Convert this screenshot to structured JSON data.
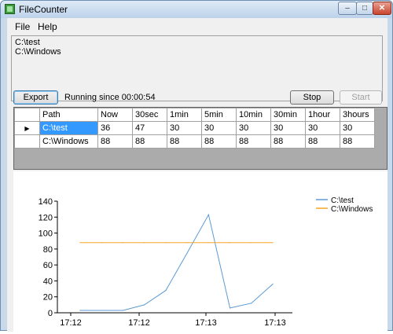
{
  "window": {
    "title": "FileCounter"
  },
  "menu": {
    "file": "File",
    "help": "Help"
  },
  "paths": [
    "C:\\test",
    "C:\\Windows"
  ],
  "toolbar": {
    "export_label": "Export",
    "status": "Running since 00:00:54",
    "stop_label": "Stop",
    "start_label": "Start"
  },
  "table": {
    "columns": [
      "Path",
      "Now",
      "30sec",
      "1min",
      "5min",
      "10min",
      "30min",
      "1hour",
      "3hours"
    ],
    "rows": [
      {
        "path": "C:\\test",
        "values": [
          "36",
          "47",
          "30",
          "30",
          "30",
          "30",
          "30",
          "30"
        ]
      },
      {
        "path": "C:\\Windows",
        "values": [
          "88",
          "88",
          "88",
          "88",
          "88",
          "88",
          "88",
          "88"
        ]
      }
    ]
  },
  "chart_data": {
    "type": "line",
    "ylim": [
      0,
      140
    ],
    "yticks": [
      0,
      20,
      40,
      60,
      80,
      100,
      120,
      140
    ],
    "xtick_labels": [
      "17:12",
      "17:12",
      "17:13",
      "17:13"
    ],
    "grid": false,
    "legend_position": "top-right",
    "series": [
      {
        "name": "C:\\test",
        "color": "#5b9bd5",
        "values": [
          3,
          3,
          3,
          10,
          28,
          75,
          123,
          6,
          12,
          36
        ]
      },
      {
        "name": "C:\\Windows",
        "color": "#f5a623",
        "values": [
          88,
          88,
          88,
          88,
          88,
          88,
          88,
          88,
          88,
          88
        ]
      }
    ]
  }
}
